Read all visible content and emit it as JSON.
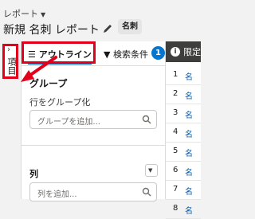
{
  "header": {
    "eyebrow": "レポート",
    "title": "新規 名刺 レポート",
    "badge": "名刺"
  },
  "rail": {
    "label": "項目"
  },
  "panel": {
    "tabs": {
      "outline": "アウトライン",
      "filters": "検索条件",
      "filters_count": "1"
    },
    "group": {
      "title": "グループ",
      "label": "行をグループ化",
      "placeholder": "グループを追加..."
    },
    "columns": {
      "title": "列",
      "placeholder": "列を追加..."
    }
  },
  "preview": {
    "header_text": "限定",
    "rows": [
      "1",
      "2",
      "3",
      "4",
      "5",
      "6",
      "7",
      "8"
    ],
    "cell": "名"
  },
  "colors": {
    "accent": "#0176d3",
    "highlight": "#e3001b"
  },
  "icons": [
    "caret-down-icon",
    "pencil-icon",
    "chevron-right-icon",
    "list-icon",
    "filter-icon",
    "search-icon",
    "info-icon"
  ]
}
